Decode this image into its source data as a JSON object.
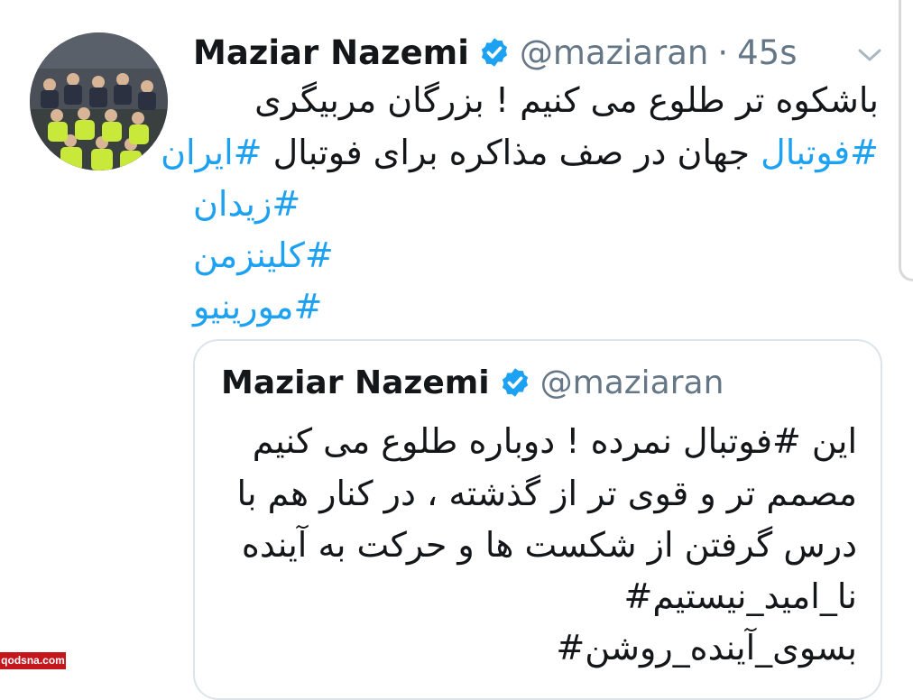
{
  "tweet": {
    "author_name": "Maziar Nazemi",
    "handle": "@maziaran",
    "time_sep": "·",
    "time": "45s",
    "icons": {
      "verified": "verified-badge-icon",
      "menu": "chevron-down-icon"
    },
    "lines": [
      {
        "plain": "باشکوه تر طلوع می کنیم ! بزرگان مربیگری"
      },
      {
        "tag1": "#فوتبال",
        "plain": " جهان در صف مذاکره برای فوتبال ",
        "tag2": "#ایران"
      },
      {
        "tag": "#زیدان"
      },
      {
        "tag": "#کلینزمن"
      },
      {
        "tag": "#مورینیو"
      }
    ]
  },
  "quoted_tweet": {
    "author_name": "Maziar Nazemi",
    "handle": "@maziaran",
    "lines": [
      "این #فوتبال نمرده ! دوباره طلوع می کنیم",
      "مصمم تر و قوی تر از گذشته ، در کنار هم با",
      "درس گرفتن از شکست ها  و حرکت به آینده",
      "نا_امید_نیستیم#",
      "بسوی_آینده_روشن#"
    ]
  },
  "watermark": "qodsna.com",
  "colors": {
    "link": "#1da1f2",
    "verified": "#1da1f2",
    "secondary": "#657786",
    "text": "#14171a",
    "watermark_bg": "#c4161c"
  }
}
